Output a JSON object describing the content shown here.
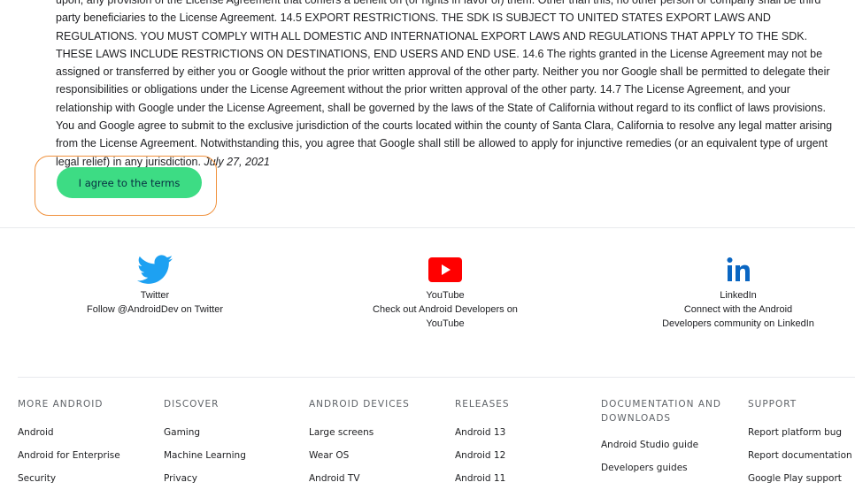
{
  "legal": {
    "text": "upon, any provision of the License Agreement that confers a benefit on (or rights in favor of) them. Other than this, no other person or company shall be third party beneficiaries to the License Agreement. 14.5 EXPORT RESTRICTIONS. THE SDK IS SUBJECT TO UNITED STATES EXPORT LAWS AND REGULATIONS. YOU MUST COMPLY WITH ALL DOMESTIC AND INTERNATIONAL EXPORT LAWS AND REGULATIONS THAT APPLY TO THE SDK. THESE LAWS INCLUDE RESTRICTIONS ON DESTINATIONS, END USERS AND END USE. 14.6 The rights granted in the License Agreement may not be assigned or transferred by either you or Google without the prior written approval of the other party. Neither you nor Google shall be permitted to delegate their responsibilities or obligations under the License Agreement without the prior written approval of the other party. 14.7 The License Agreement, and your relationship with Google under the License Agreement, shall be governed by the laws of the State of California without regard to its conflict of laws provisions. You and Google agree to submit to the exclusive jurisdiction of the courts located within the county of Santa Clara, California to resolve any legal matter arising from the License Agreement. Notwithstanding this, you agree that Google shall still be allowed to apply for injunctive remedies (or an equivalent type of urgent legal relief) in any jurisdiction. ",
    "date": "July 27, 2021"
  },
  "agree_button": {
    "label": "I agree to the terms"
  },
  "social": [
    {
      "name": "Twitter",
      "desc": "Follow @AndroidDev on Twitter",
      "icon": "twitter-icon",
      "color": "#1da1f2"
    },
    {
      "name": "YouTube",
      "desc": "Check out Android Developers on YouTube",
      "icon": "youtube-icon",
      "color": "#ff0000"
    },
    {
      "name": "LinkedIn",
      "desc": "Connect with the Android Developers community on LinkedIn",
      "icon": "linkedin-icon",
      "color": "#0a66c2"
    }
  ],
  "footer": {
    "columns": [
      {
        "heading": "MORE ANDROID",
        "links": [
          "Android",
          "Android for Enterprise",
          "Security"
        ]
      },
      {
        "heading": "DISCOVER",
        "links": [
          "Gaming",
          "Machine Learning",
          "Privacy"
        ]
      },
      {
        "heading": "ANDROID DEVICES",
        "links": [
          "Large screens",
          "Wear OS",
          "Android TV"
        ]
      },
      {
        "heading": "RELEASES",
        "links": [
          "Android 13",
          "Android 12",
          "Android 11"
        ]
      },
      {
        "heading": "DOCUMENTATION AND DOWNLOADS",
        "links": [
          "Android Studio guide",
          "Developers guides"
        ]
      },
      {
        "heading": "SUPPORT",
        "links": [
          "Report platform bug",
          "Report documentation bug",
          "Google Play support"
        ]
      }
    ]
  },
  "colors": {
    "accent_green": "#3ddc84",
    "highlight_outline": "#f0913c"
  }
}
